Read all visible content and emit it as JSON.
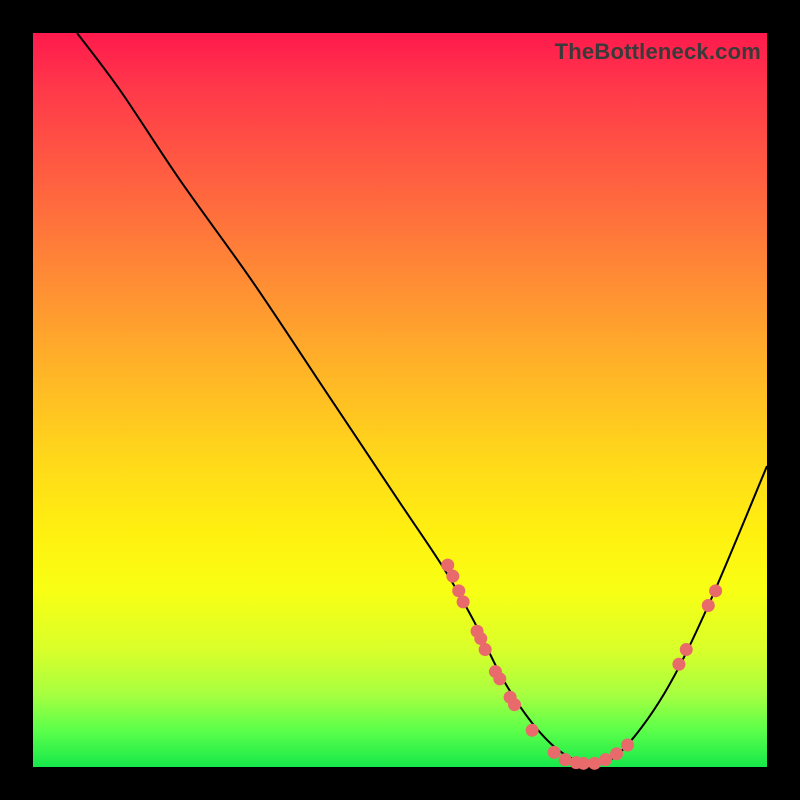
{
  "watermark": "TheBottleneck.com",
  "colors": {
    "background": "#000000",
    "curve": "#000000",
    "marker": "#e86a6a"
  },
  "chart_data": {
    "type": "line",
    "title": "",
    "xlabel": "",
    "ylabel": "",
    "xlim": [
      0,
      100
    ],
    "ylim": [
      0,
      100
    ],
    "grid": false,
    "legend": null,
    "series": [
      {
        "name": "curve",
        "x": [
          6,
          12,
          20,
          30,
          40,
          50,
          56,
          60,
          64,
          68,
          72,
          76,
          80,
          86,
          92,
          100
        ],
        "y": [
          100,
          92,
          80,
          66,
          51,
          36,
          27,
          20,
          12,
          6,
          2,
          0.5,
          2,
          10,
          22,
          41
        ]
      }
    ],
    "markers": [
      {
        "x": 56.5,
        "y": 27.5
      },
      {
        "x": 57.2,
        "y": 26.0
      },
      {
        "x": 58.0,
        "y": 24.0
      },
      {
        "x": 58.6,
        "y": 22.5
      },
      {
        "x": 60.5,
        "y": 18.5
      },
      {
        "x": 61.0,
        "y": 17.5
      },
      {
        "x": 61.6,
        "y": 16.0
      },
      {
        "x": 63.0,
        "y": 13.0
      },
      {
        "x": 63.6,
        "y": 12.0
      },
      {
        "x": 65.0,
        "y": 9.5
      },
      {
        "x": 65.6,
        "y": 8.5
      },
      {
        "x": 68.0,
        "y": 5.0
      },
      {
        "x": 71.0,
        "y": 2.0
      },
      {
        "x": 72.5,
        "y": 1.0
      },
      {
        "x": 74.0,
        "y": 0.6
      },
      {
        "x": 75.0,
        "y": 0.5
      },
      {
        "x": 76.5,
        "y": 0.5
      },
      {
        "x": 78.0,
        "y": 1.0
      },
      {
        "x": 79.5,
        "y": 1.8
      },
      {
        "x": 81.0,
        "y": 3.0
      },
      {
        "x": 88.0,
        "y": 14.0
      },
      {
        "x": 89.0,
        "y": 16.0
      },
      {
        "x": 92.0,
        "y": 22.0
      },
      {
        "x": 93.0,
        "y": 24.0
      }
    ]
  }
}
